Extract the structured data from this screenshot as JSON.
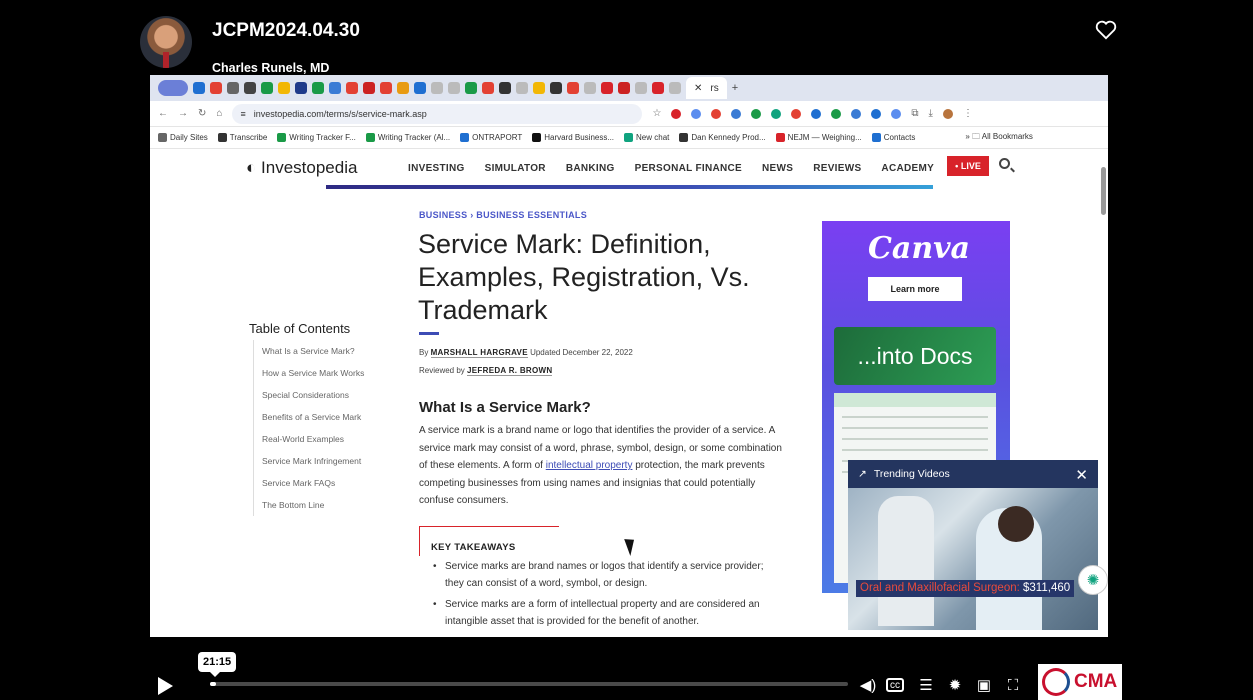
{
  "player": {
    "title": "JCPM2024.04.30",
    "author": "Charles Runels, MD",
    "timestamp": "21:15",
    "progress_fraction": 0.01,
    "brand_text": "CMA"
  },
  "browser": {
    "url": "investopedia.com/terms/s/service-mark.asp",
    "active_tab_label": "rs",
    "bookmarks": [
      {
        "label": "Daily Sites",
        "color": "#666"
      },
      {
        "label": "Transcribe",
        "color": "#333"
      },
      {
        "label": "Writing Tracker F...",
        "color": "#1a9a47"
      },
      {
        "label": "Writing Tracker (Al...",
        "color": "#1a9a47"
      },
      {
        "label": "ONTRAPORT",
        "color": "#1f6fd1"
      },
      {
        "label": "Harvard Business...",
        "color": "#111"
      },
      {
        "label": "New chat",
        "color": "#10a37f"
      },
      {
        "label": "Dan Kennedy Prod...",
        "color": "#333"
      },
      {
        "label": "NEJM — Weighing...",
        "color": "#d8232a"
      },
      {
        "label": "Contacts",
        "color": "#1f6fd1"
      }
    ],
    "all_bookmarks": "All Bookmarks"
  },
  "site": {
    "logo": "Investopedia",
    "nav": [
      "INVESTING",
      "SIMULATOR",
      "BANKING",
      "PERSONAL FINANCE",
      "NEWS",
      "REVIEWS",
      "ACADEMY"
    ],
    "live": "• LIVE"
  },
  "article": {
    "breadcrumb": "BUSINESS › BUSINESS ESSENTIALS",
    "title": "Service Mark: Definition, Examples, Registration, Vs. Trademark",
    "by_label": "By",
    "author": "MARSHALL HARGRAVE",
    "updated": "Updated December 22, 2022",
    "reviewed_label": "Reviewed by",
    "reviewer": "JEFREDA R. BROWN",
    "section_heading": "What Is a Service Mark?",
    "para_before_link": "A service mark is a brand name or logo that identifies the provider of a service. A service mark may consist of a word, phrase, symbol, design, or some combination of these elements. A form of ",
    "para_link": "intellectual property",
    "para_after_link": " protection, the mark prevents competing businesses from using names and insignias that could potentially confuse consumers.",
    "takeaways_title": "KEY TAKEAWAYS",
    "takeaways": [
      "Service marks are brand names or logos that identify a service provider; they can consist of a word, symbol, or design.",
      "Service marks are a form of intellectual property and are considered an intangible asset that is provided for the benefit of another."
    ]
  },
  "toc": {
    "title": "Table of Contents",
    "items": [
      "What Is a Service Mark?",
      "How a Service Mark Works",
      "Special Considerations",
      "Benefits of a Service Mark",
      "Real-World Examples",
      "Service Mark Infringement",
      "Service Mark FAQs",
      "The Bottom Line"
    ]
  },
  "ad": {
    "brand": "Canva",
    "cta": "Learn more",
    "card_text": "...into Docs"
  },
  "trending": {
    "header": "Trending Videos",
    "caption_red": "Oral and Maxillofacial Surgeon:",
    "caption_white": "$311,460"
  }
}
